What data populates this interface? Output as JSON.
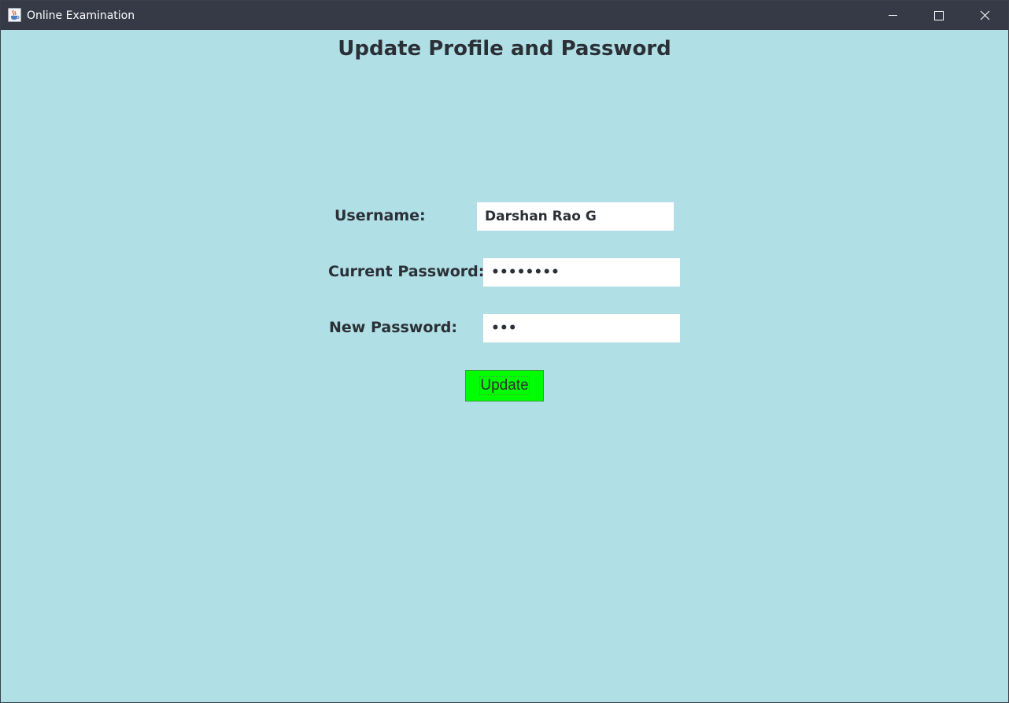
{
  "window": {
    "title": "Online Examination",
    "icon": "java-cup-icon"
  },
  "page": {
    "title": "Update Profile and Password"
  },
  "form": {
    "username_label": "Username:",
    "username_value": "Darshan Rao G",
    "current_password_label": "Current Password:",
    "current_password_value": "••••••••",
    "new_password_label": "New Password:",
    "new_password_value": "•••",
    "update_label": "Update"
  },
  "colors": {
    "background": "#b0dfe5",
    "titlebar": "#353a46",
    "button": "#00ff00",
    "text": "#2b2f36"
  }
}
